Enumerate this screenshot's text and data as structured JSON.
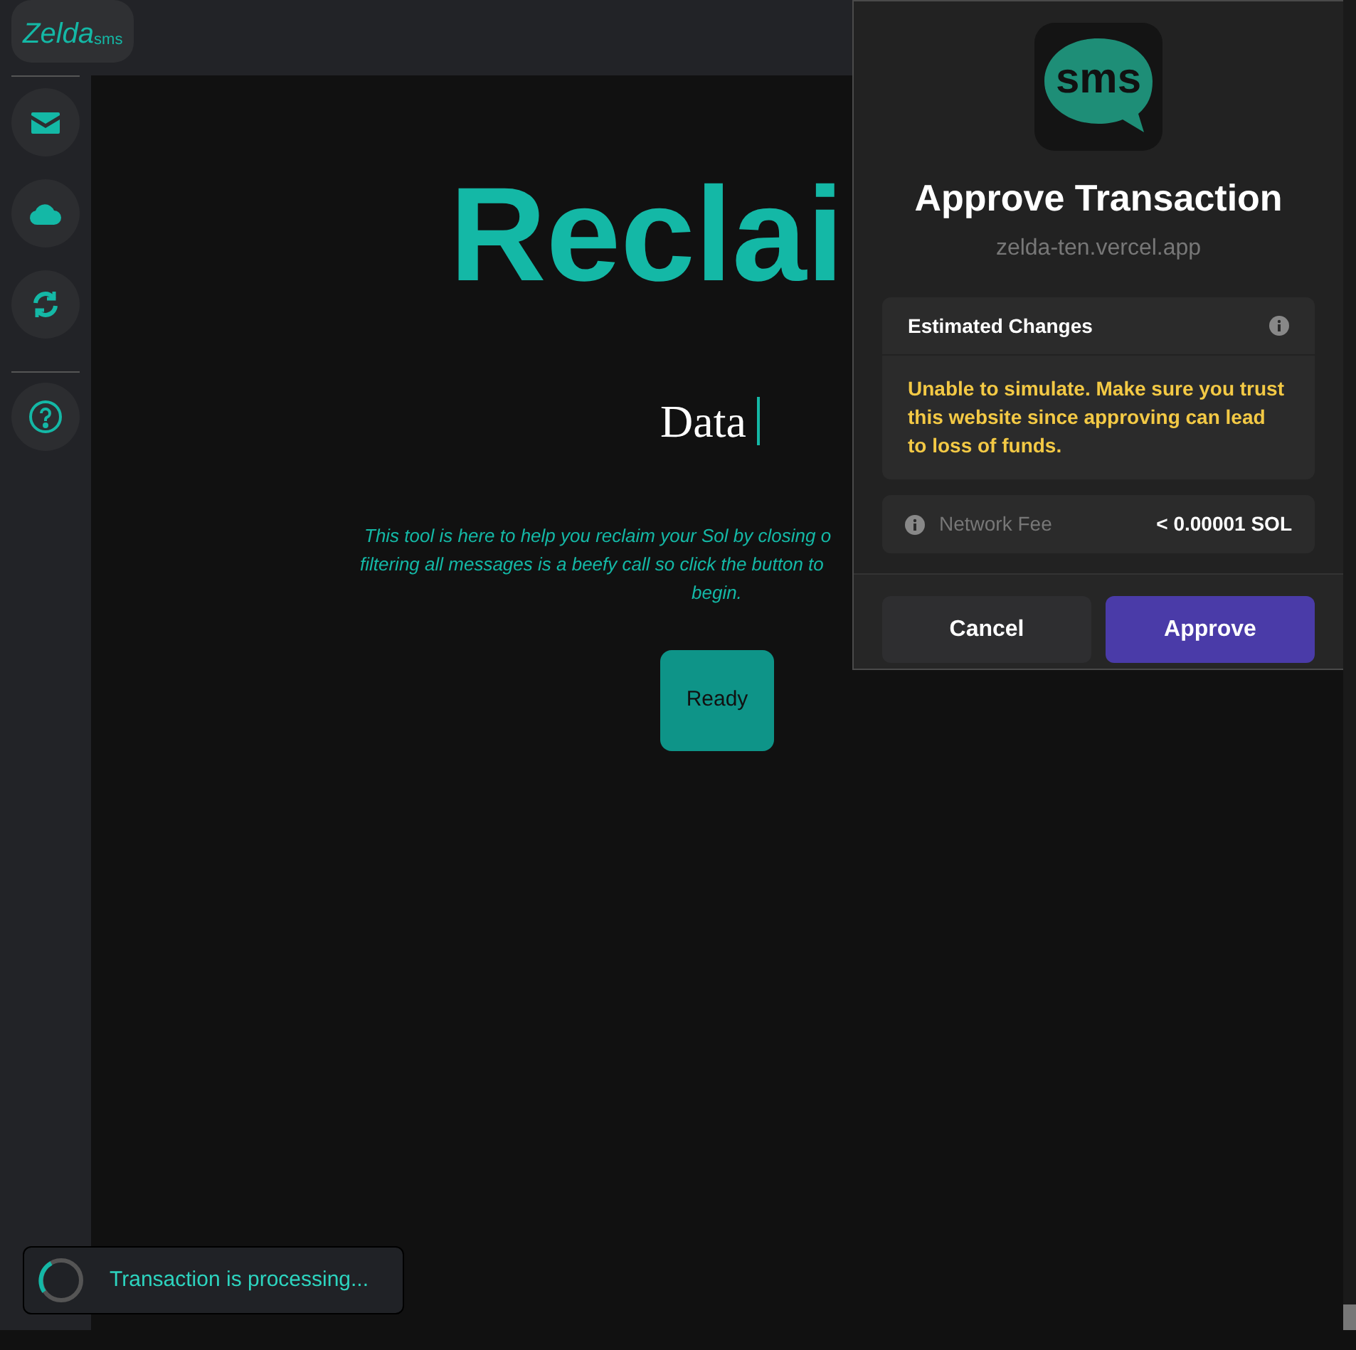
{
  "header": {
    "logo": "Zelda",
    "logo_suffix": "sms"
  },
  "sidebar": {
    "items": [
      {
        "kind": "mail"
      },
      {
        "kind": "cloud"
      },
      {
        "kind": "sync"
      },
      {
        "kind": "help"
      }
    ]
  },
  "main": {
    "title": "Reclai",
    "typed": "Data",
    "description": [
      "This tool is here to help you reclaim your Sol by closing o",
      "filtering all messages is a beefy call so click the button to",
      "begin."
    ],
    "button": "Ready"
  },
  "popup": {
    "app_logo_text": "sms",
    "title": "Approve Transaction",
    "site": "zelda-ten.vercel.app",
    "changes_title": "Estimated Changes",
    "warning": "Unable to simulate. Make sure you trust this website since approving can lead to loss of funds.",
    "fee_label": "Network Fee",
    "fee_value": "< 0.00001 SOL",
    "buttons": [
      {
        "label": "Cancel",
        "kind": "secondary"
      },
      {
        "label": "Approve",
        "kind": "primary"
      }
    ]
  },
  "toast": {
    "message": "Transaction is processing..."
  }
}
